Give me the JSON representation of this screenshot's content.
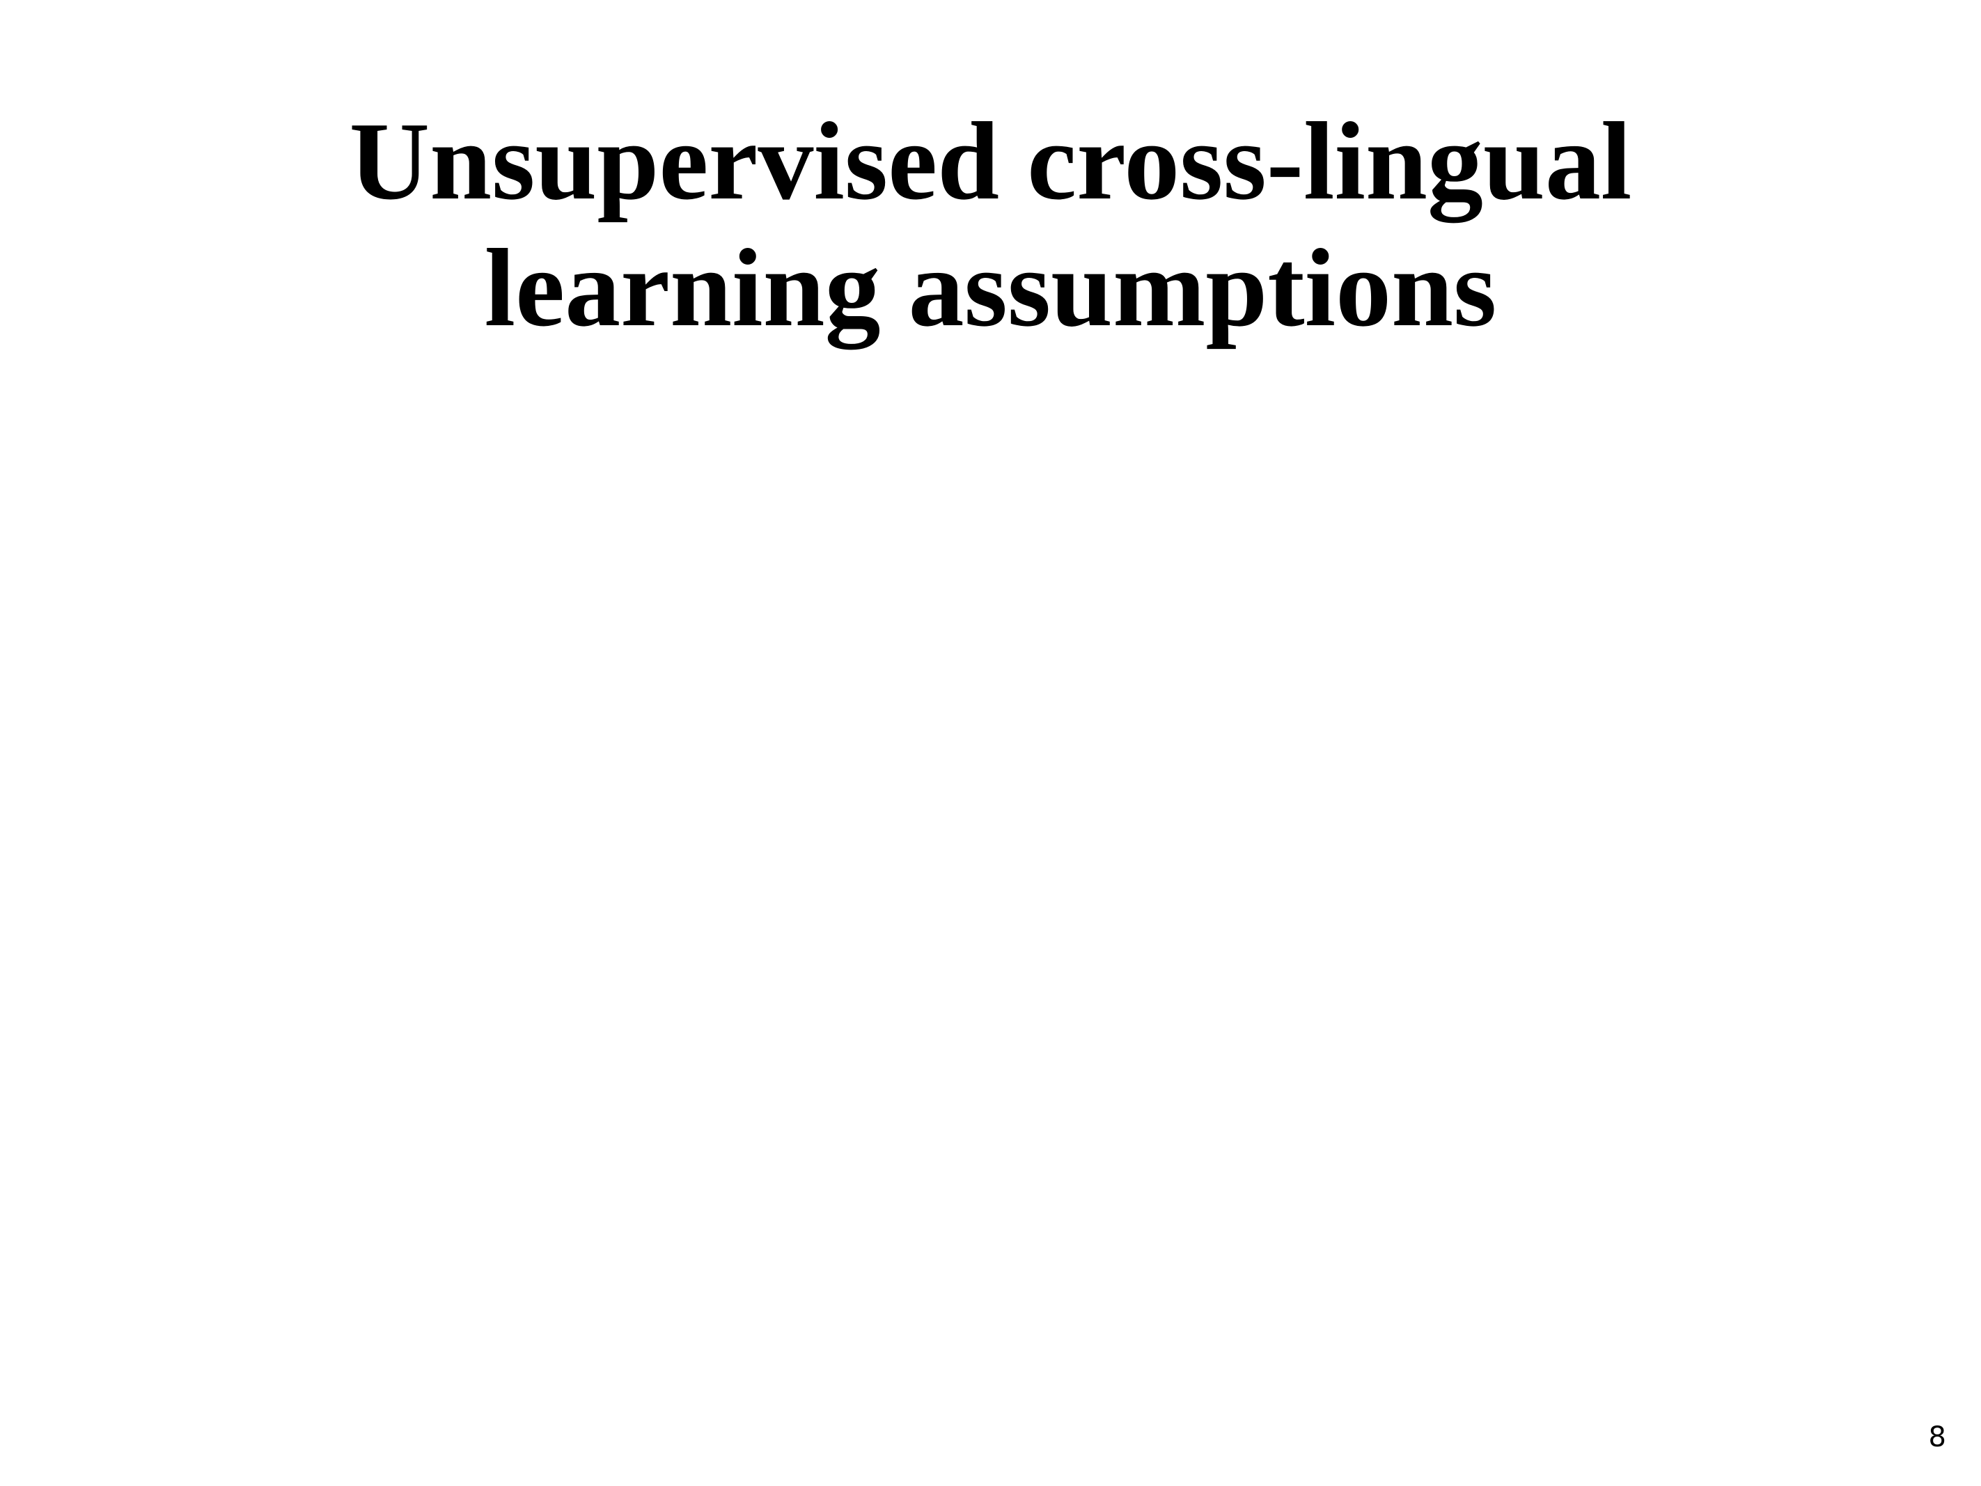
{
  "slide": {
    "title_line_1": "Unsupervised cross-lingual",
    "title_line_2": "learning assumptions",
    "page_number": "8"
  }
}
